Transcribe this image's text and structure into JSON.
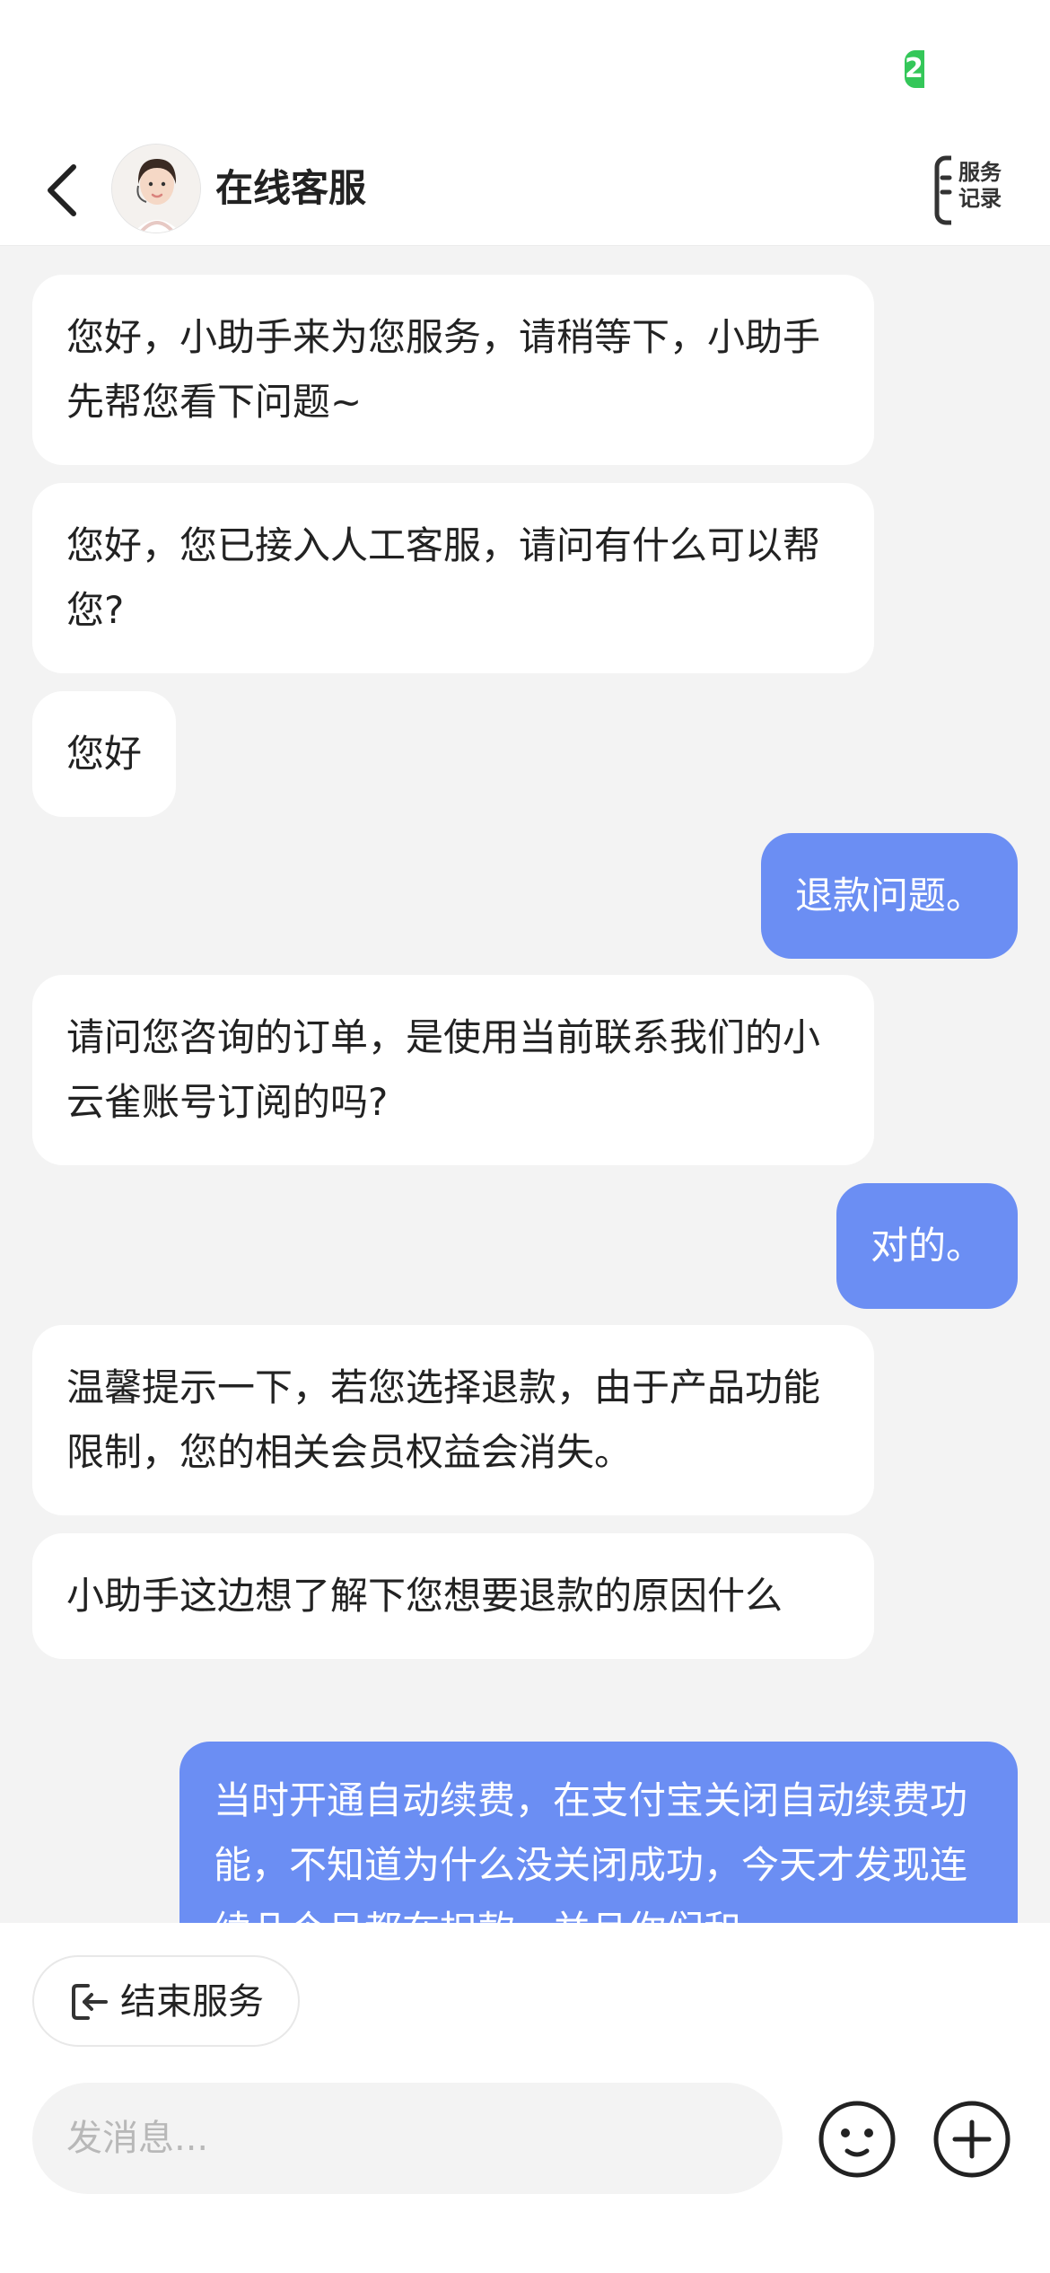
{
  "status_bar": {
    "battery_text": "2"
  },
  "header": {
    "title": "在线客服",
    "records_label": "服务\n记录"
  },
  "messages": [
    {
      "from": "agent",
      "text": "您好，小助手来为您服务，请稍等下，小助手先帮您看下问题~"
    },
    {
      "from": "agent",
      "text": "您好，您已接入人工客服，请问有什么可以帮您?"
    },
    {
      "from": "agent",
      "text": "您好"
    },
    {
      "from": "user",
      "text": "退款问题。"
    },
    {
      "from": "agent",
      "text": "请问您咨询的订单，是使用当前联系我们的小云雀账号订阅的吗?"
    },
    {
      "from": "user",
      "text": "对的。"
    },
    {
      "from": "agent",
      "text": "温馨提示一下，若您选择退款，由于产品功能限制，您的相关会员权益会消失。"
    },
    {
      "from": "agent",
      "text": "小助手这边想了解下您想要退款的原因什么"
    },
    {
      "from": "user",
      "text": "当时开通自动续费，在支付宝关闭自动续费功能，不知道为什么没关闭成功，今天才发现连续几个月都在扣款，并且你们和"
    }
  ],
  "footer": {
    "end_service_label": "结束服务",
    "input_placeholder": "发消息..."
  },
  "colors": {
    "user_bubble": "#6b8ef3",
    "agent_bubble": "#ffffff",
    "background": "#f3f3f3",
    "status_green": "#34c759"
  }
}
